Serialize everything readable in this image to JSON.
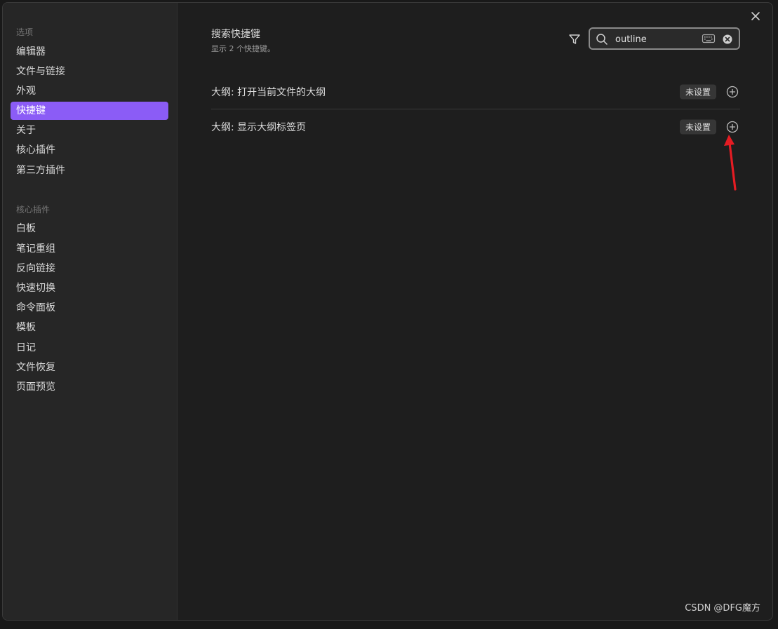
{
  "sidebar": {
    "options_section": {
      "title": "选项",
      "items": [
        {
          "label": "编辑器",
          "active": false
        },
        {
          "label": "文件与链接",
          "active": false
        },
        {
          "label": "外观",
          "active": false
        },
        {
          "label": "快捷键",
          "active": true
        },
        {
          "label": "关于",
          "active": false
        },
        {
          "label": "核心插件",
          "active": false
        },
        {
          "label": "第三方插件",
          "active": false
        }
      ]
    },
    "core_plugins_section": {
      "title": "核心插件",
      "items": [
        {
          "label": "白板"
        },
        {
          "label": "笔记重组"
        },
        {
          "label": "反向链接"
        },
        {
          "label": "快速切换"
        },
        {
          "label": "命令面板"
        },
        {
          "label": "模板"
        },
        {
          "label": "日记"
        },
        {
          "label": "文件恢复"
        },
        {
          "label": "页面预览"
        }
      ]
    }
  },
  "main": {
    "title": "搜索快捷键",
    "subtitle": "显示 2 个快捷键。",
    "search": {
      "value": "outline"
    },
    "hotkeys": [
      {
        "name": "大纲: 打开当前文件的大纲",
        "status": "未设置"
      },
      {
        "name": "大纲: 显示大纲标签页",
        "status": "未设置"
      }
    ]
  },
  "icons": {
    "close": "close-icon",
    "filter": "filter-icon",
    "search": "search-icon",
    "keyboard": "keyboard-icon",
    "clear": "clear-icon",
    "add": "plus-circle-icon"
  },
  "colors": {
    "accent": "#8b5cf6",
    "annotation_arrow": "#e51c23"
  },
  "watermark": "CSDN @DFG魔方"
}
